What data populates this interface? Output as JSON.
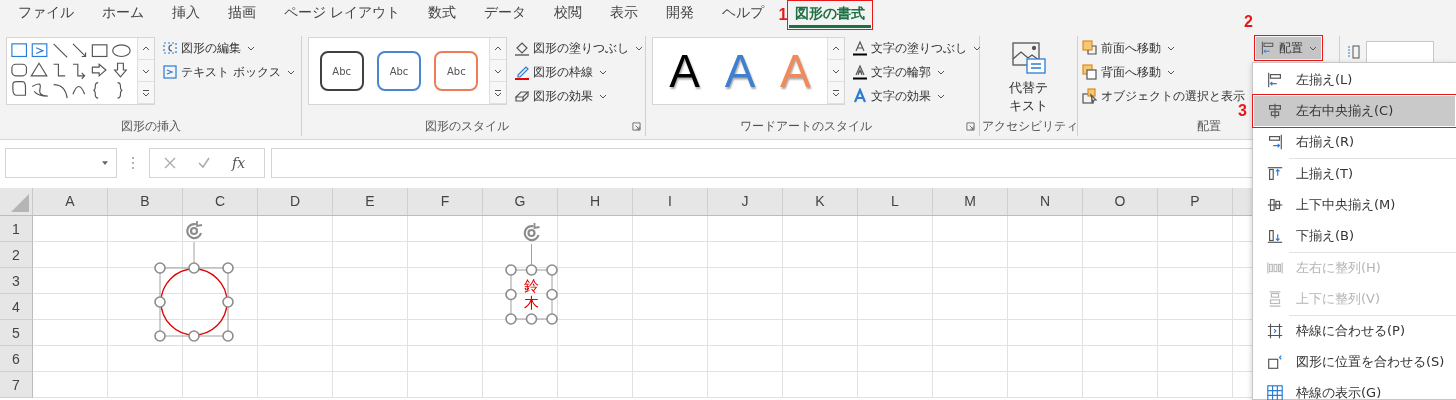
{
  "tabs": [
    {
      "label": "ファイル",
      "selected": false
    },
    {
      "label": "ホーム",
      "selected": false
    },
    {
      "label": "挿入",
      "selected": false
    },
    {
      "label": "描画",
      "selected": false
    },
    {
      "label": "ページ レイアウト",
      "selected": false
    },
    {
      "label": "数式",
      "selected": false
    },
    {
      "label": "データ",
      "selected": false
    },
    {
      "label": "校閲",
      "selected": false
    },
    {
      "label": "表示",
      "selected": false
    },
    {
      "label": "開発",
      "selected": false
    },
    {
      "label": "ヘルプ",
      "selected": false
    },
    {
      "label": "図形の書式",
      "selected": true,
      "callout": "1"
    }
  ],
  "ribbon": {
    "groups": [
      {
        "kind": "insert-shapes",
        "label": "図形の挿入",
        "buttons": [
          {
            "label": "図形の編集",
            "dropdown": true
          },
          {
            "label": "テキスト ボックス",
            "dropdown": true
          }
        ]
      },
      {
        "kind": "shape-styles",
        "label": "図形のスタイル",
        "gallery": [
          {
            "text": "Abc",
            "color": "#404040"
          },
          {
            "text": "Abc",
            "color": "#4a86d0"
          },
          {
            "text": "Abc",
            "color": "#ed7d55"
          }
        ],
        "buttons": [
          {
            "label": "図形の塗りつぶし",
            "dropdown": true
          },
          {
            "label": "図形の枠線",
            "dropdown": true
          },
          {
            "label": "図形の効果",
            "dropdown": true
          }
        ]
      },
      {
        "kind": "wordart",
        "label": "ワードアートのスタイル",
        "gallery": [
          {
            "text": "A",
            "color": "#000000"
          },
          {
            "text": "A",
            "color": "#3f7fd0"
          },
          {
            "text": "A",
            "color": "#f08a5a"
          }
        ],
        "buttons": [
          {
            "label": "文字の塗りつぶし",
            "dropdown": true
          },
          {
            "label": "文字の輪郭",
            "dropdown": true
          },
          {
            "label": "文字の効果",
            "dropdown": true
          }
        ]
      },
      {
        "kind": "accessibility",
        "label": "アクセシビリティ",
        "buttons": [
          {
            "label": "代替テキスト"
          }
        ]
      },
      {
        "kind": "arrange",
        "label": "配置",
        "buttons": [
          {
            "label": "前面へ移動",
            "dropdown": true
          },
          {
            "label": "背面へ移動",
            "dropdown": true
          },
          {
            "label": "オブジェクトの選択と表示",
            "dropdown": false
          }
        ],
        "arrange_button": {
          "label": "配置",
          "callout": "2",
          "expanded": true
        }
      },
      {
        "kind": "size"
      }
    ]
  },
  "formula_bar": {
    "function_label": "fx"
  },
  "sheet": {
    "columns": [
      "A",
      "B",
      "C",
      "D",
      "E",
      "F",
      "G",
      "H",
      "I",
      "J",
      "K",
      "L",
      "M",
      "N",
      "O",
      "P"
    ],
    "rows": [
      "1",
      "2",
      "3",
      "4",
      "5",
      "6",
      "7"
    ],
    "shapes": [
      {
        "kind": "ellipse",
        "selected": true
      },
      {
        "kind": "textbox",
        "text": "鈴木",
        "selected": true
      }
    ]
  },
  "menu": {
    "sections": [
      {
        "items": [
          {
            "label": "左揃え(L)",
            "selected": false,
            "disabled": false
          },
          {
            "label": "左右中央揃え(C)",
            "selected": true,
            "disabled": false,
            "callout": "3"
          },
          {
            "label": "右揃え(R)",
            "selected": false,
            "disabled": false
          }
        ]
      },
      {
        "items": [
          {
            "label": "上揃え(T)",
            "selected": false,
            "disabled": false
          },
          {
            "label": "上下中央揃え(M)",
            "selected": false,
            "disabled": false
          },
          {
            "label": "下揃え(B)",
            "selected": false,
            "disabled": false
          }
        ]
      },
      {
        "items": [
          {
            "label": "左右に整列(H)",
            "selected": false,
            "disabled": true
          },
          {
            "label": "上下に整列(V)",
            "selected": false,
            "disabled": true
          }
        ]
      },
      {
        "items": [
          {
            "label": "枠線に合わせる(P)",
            "selected": false,
            "disabled": false
          },
          {
            "label": "図形に位置を合わせる(S)",
            "selected": false,
            "disabled": false
          },
          {
            "label": "枠線の表示(G)",
            "selected": false,
            "disabled": false
          }
        ]
      }
    ]
  }
}
